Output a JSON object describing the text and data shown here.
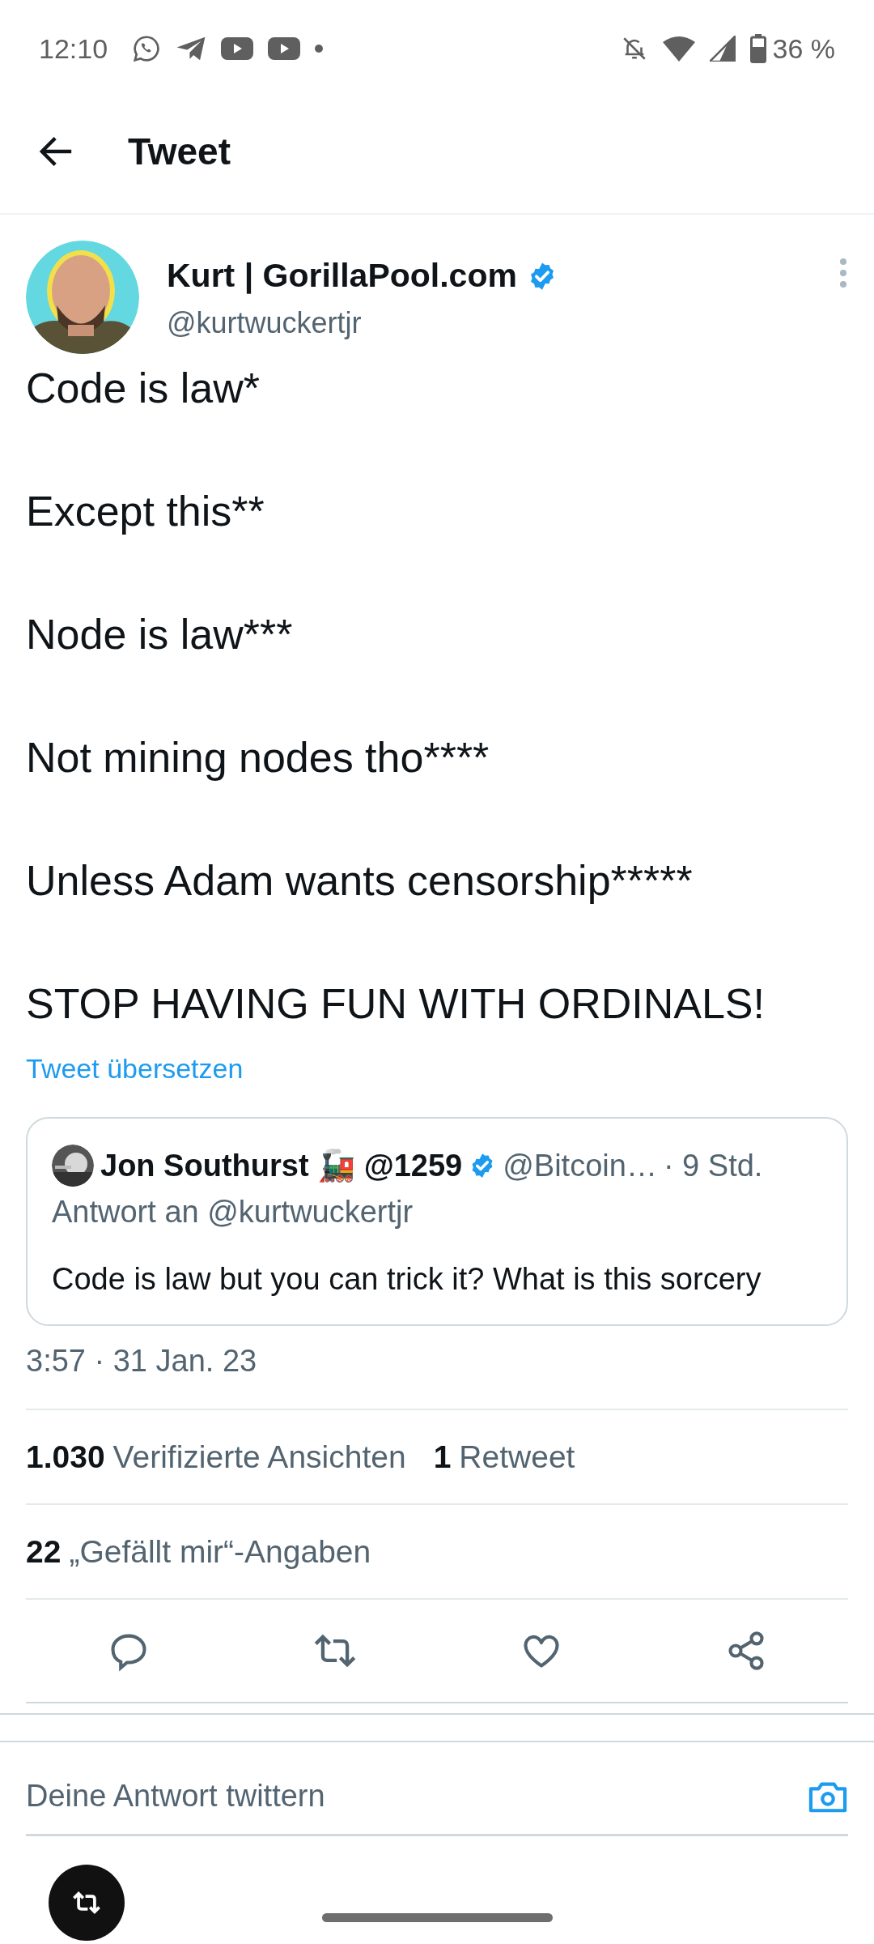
{
  "status_bar": {
    "time": "12:10",
    "battery": "36 %"
  },
  "header": {
    "title": "Tweet"
  },
  "tweet": {
    "author": "Kurt | GorillaPool.com",
    "handle": "@kurtwuckertjr",
    "paragraphs": [
      "Code is law*",
      "Except this**",
      "Node is law***",
      "Not mining nodes tho****",
      "Unless Adam wants censorship*****",
      "STOP HAVING FUN WITH ORDINALS!"
    ],
    "translate": "Tweet übersetzen",
    "quote": {
      "author": "Jon Southurst 🚂 @1259",
      "handle": "@Bitcoin…",
      "time": "· 9 Std.",
      "reply_to": "Antwort an @kurtwuckertjr",
      "text": "Code is law but you can trick it? What is this sorcery"
    },
    "timestamp": "3:57 · 31 Jan. 23",
    "stat_rows": [
      [
        {
          "count": "1.030",
          "label": "Verifizierte Ansichten"
        },
        {
          "count": "1",
          "label": "Retweet"
        }
      ],
      [
        {
          "count": "22",
          "label": "„Gefällt mir“-Angaben"
        }
      ]
    ]
  },
  "reply": {
    "placeholder": "Deine Antwort twittern"
  }
}
